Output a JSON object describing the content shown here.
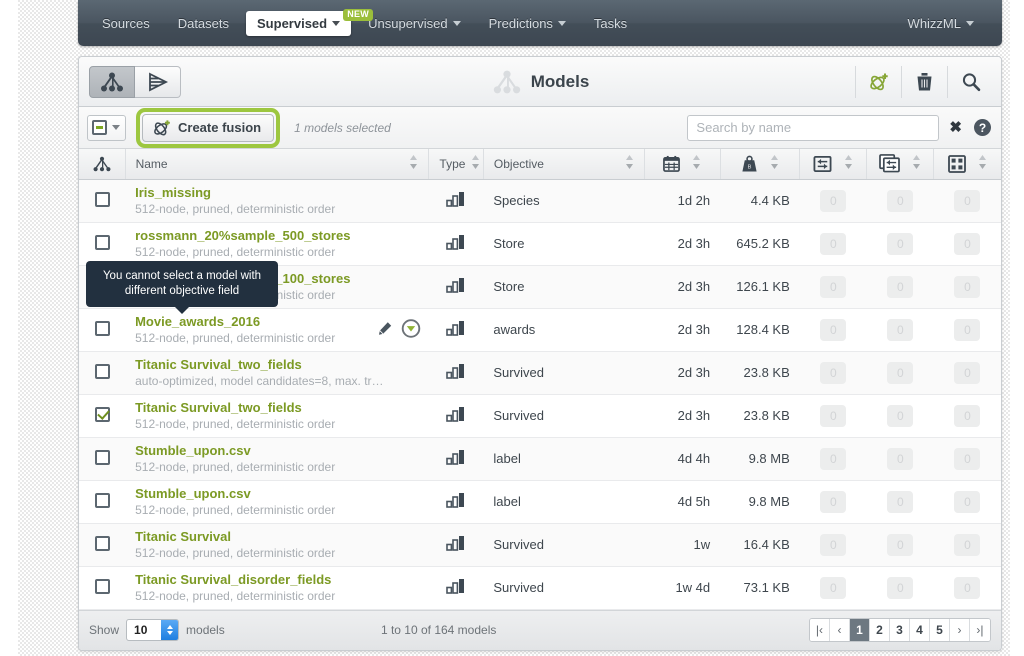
{
  "topnav": {
    "items": [
      {
        "label": "Sources",
        "active": false,
        "caret": false,
        "badge": null
      },
      {
        "label": "Datasets",
        "active": false,
        "caret": false,
        "badge": null
      },
      {
        "label": "Supervised",
        "active": true,
        "caret": true,
        "badge": "NEW"
      },
      {
        "label": "Unsupervised",
        "active": false,
        "caret": true,
        "badge": null
      },
      {
        "label": "Predictions",
        "active": false,
        "caret": true,
        "badge": null
      },
      {
        "label": "Tasks",
        "active": false,
        "caret": false,
        "badge": null
      }
    ],
    "right": {
      "label": "WhizzML",
      "caret": true
    }
  },
  "panel": {
    "title": "Models",
    "view_tabs": [
      {
        "icon": "model-tree-icon",
        "name": "view-models-tab",
        "active": true
      },
      {
        "icon": "ensemble-icon",
        "name": "view-ensembles-tab",
        "active": false
      }
    ],
    "header_actions": [
      {
        "icon": "create-fusion-icon",
        "name": "header-create-fusion-button"
      },
      {
        "icon": "trash-icon",
        "name": "header-delete-button"
      },
      {
        "icon": "search-icon",
        "name": "header-search-button"
      }
    ]
  },
  "toolbar": {
    "select_all_state": "indeterminate",
    "create_fusion_label": "Create fusion",
    "selection_text": "1 models selected",
    "search_placeholder": "Search by name",
    "search_value": "",
    "clear_label": "✖",
    "help_label": "?"
  },
  "tooltip": {
    "line1": "You cannot select a model with",
    "line2": "different objective field"
  },
  "table": {
    "columns": [
      {
        "label": "",
        "name": "col-select",
        "icon": "model-tree-icon",
        "sortable": false
      },
      {
        "label": "Name",
        "name": "col-name",
        "sortable": true
      },
      {
        "label": "Type",
        "name": "col-type",
        "sortable": true
      },
      {
        "label": "Objective",
        "name": "col-objective",
        "sortable": true
      },
      {
        "label": "",
        "name": "col-age",
        "icon": "calendar-icon",
        "sortable": true
      },
      {
        "label": "",
        "name": "col-size",
        "icon": "weight-icon",
        "sortable": true
      },
      {
        "label": "",
        "name": "col-evaluations",
        "icon": "single-prediction-icon",
        "sortable": true
      },
      {
        "label": "",
        "name": "col-batch-predictions",
        "icon": "batch-prediction-icon",
        "sortable": true
      },
      {
        "label": "",
        "name": "col-clusters",
        "icon": "grid-icon",
        "sortable": true
      }
    ],
    "rows": [
      {
        "checked": false,
        "name": "Iris_missing",
        "desc": "512-node, pruned, deterministic order",
        "type": "categorical-bars-icon",
        "objective": "Species",
        "age": "1d 2h",
        "size": "4.4 KB",
        "c1": "0",
        "c2": "0",
        "c3": "0",
        "actions": false
      },
      {
        "checked": false,
        "name": "rossmann_20%sample_500_stores",
        "desc": "512-node, pruned, deterministic order",
        "type": "categorical-bars-icon",
        "objective": "Store",
        "age": "2d 3h",
        "size": "645.2 KB",
        "c1": "0",
        "c2": "0",
        "c3": "0",
        "actions": false
      },
      {
        "checked": false,
        "name": "rossmann_20%sample_100_stores",
        "desc": "512-node, pruned, deterministic order",
        "type": "categorical-bars-icon",
        "objective": "Store",
        "age": "2d 3h",
        "size": "126.1 KB",
        "c1": "0",
        "c2": "0",
        "c3": "0",
        "actions": false
      },
      {
        "checked": false,
        "name": "Movie_awards_2016",
        "desc": "512-node, pruned, deterministic order",
        "type": "categorical-bars-icon",
        "objective": "awards",
        "age": "2d 3h",
        "size": "128.4 KB",
        "c1": "0",
        "c2": "0",
        "c3": "0",
        "actions": true
      },
      {
        "checked": false,
        "name": "Titanic Survival_two_fields",
        "desc": "auto-optimized, model candidates=8, max. tr…",
        "type": "categorical-bars-icon",
        "objective": "Survived",
        "age": "2d 3h",
        "size": "23.8 KB",
        "c1": "0",
        "c2": "0",
        "c3": "0",
        "actions": false
      },
      {
        "checked": true,
        "name": "Titanic Survival_two_fields",
        "desc": "512-node, pruned, deterministic order",
        "type": "categorical-bars-icon",
        "objective": "Survived",
        "age": "2d 3h",
        "size": "23.8 KB",
        "c1": "0",
        "c2": "0",
        "c3": "0",
        "actions": false
      },
      {
        "checked": false,
        "name": "Stumble_upon.csv",
        "desc": "512-node, pruned, deterministic order",
        "type": "categorical-bars-icon",
        "objective": "label",
        "age": "4d 4h",
        "size": "9.8 MB",
        "c1": "0",
        "c2": "0",
        "c3": "0",
        "actions": false
      },
      {
        "checked": false,
        "name": "Stumble_upon.csv",
        "desc": "512-node, pruned, deterministic order",
        "type": "categorical-bars-icon",
        "objective": "label",
        "age": "4d 5h",
        "size": "9.8 MB",
        "c1": "0",
        "c2": "0",
        "c3": "0",
        "actions": false
      },
      {
        "checked": false,
        "name": "Titanic Survival",
        "desc": "512-node, pruned, deterministic order",
        "type": "categorical-bars-icon",
        "objective": "Survived",
        "age": "1w",
        "size": "16.4 KB",
        "c1": "0",
        "c2": "0",
        "c3": "0",
        "actions": false
      },
      {
        "checked": false,
        "name": "Titanic Survival_disorder_fields",
        "desc": "512-node, pruned, deterministic order",
        "type": "categorical-bars-icon",
        "objective": "Survived",
        "age": "1w 4d",
        "size": "73.1 KB",
        "c1": "0",
        "c2": "0",
        "c3": "0",
        "actions": false
      }
    ]
  },
  "footer": {
    "show_label": "Show",
    "page_size": "10",
    "models_label": "models",
    "range_text": "1 to 10 of 164 models",
    "pager": [
      {
        "label": "|‹",
        "name": "pager-first",
        "type": "nav"
      },
      {
        "label": "‹",
        "name": "pager-prev",
        "type": "nav"
      },
      {
        "label": "1",
        "name": "pager-page-1",
        "type": "num",
        "current": true
      },
      {
        "label": "2",
        "name": "pager-page-2",
        "type": "num",
        "current": false
      },
      {
        "label": "3",
        "name": "pager-page-3",
        "type": "num",
        "current": false
      },
      {
        "label": "4",
        "name": "pager-page-4",
        "type": "num",
        "current": false
      },
      {
        "label": "5",
        "name": "pager-page-5",
        "type": "num",
        "current": false
      },
      {
        "label": "›",
        "name": "pager-next",
        "type": "nav"
      },
      {
        "label": "›|",
        "name": "pager-last",
        "type": "nav"
      }
    ]
  },
  "colors": {
    "nav_bg": "#47525d",
    "accent_green": "#9dc740",
    "link_green": "#7c9a24",
    "tooltip_bg": "#22303f",
    "pager_current": "#6d7881"
  }
}
